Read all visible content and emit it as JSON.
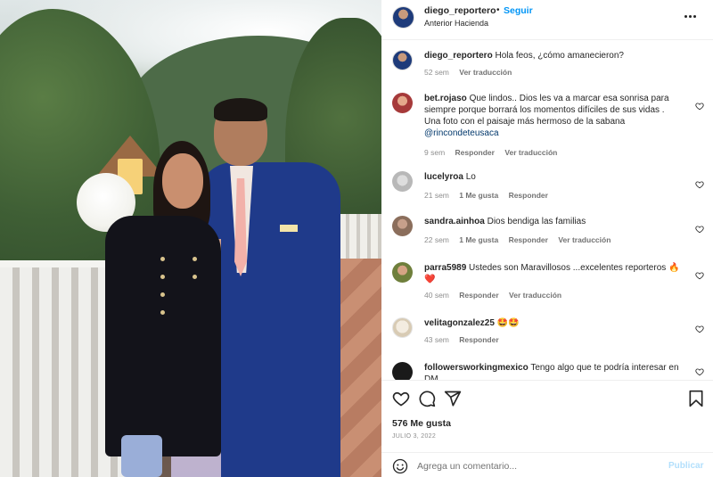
{
  "post": {
    "username": "diego_reportero",
    "separator": "•",
    "follow_label": "Seguir",
    "location": "Anterior Hacienda",
    "caption": "Hola feos, ¿cómo amanecieron?",
    "caption_time": "52 sem",
    "caption_translate": "Ver traducción"
  },
  "comments": [
    {
      "user": "bet.rojaso",
      "text": "Que lindos.. Dios les va a marcar esa sonrisa para siempre porque borrará los momentos difíciles de sus vidas . Una foto con el paisaje más hermoso de la sabana",
      "mention": "@rincondeteusaca",
      "time": "9 sem",
      "likes": "",
      "reply": "Responder",
      "translate": "Ver traducción"
    },
    {
      "user": "lucelyroa",
      "text": "Lo",
      "mention": "",
      "time": "21 sem",
      "likes": "1 Me gusta",
      "reply": "Responder",
      "translate": ""
    },
    {
      "user": "sandra.ainhoa",
      "text": "Dios bendiga las familias",
      "mention": "",
      "time": "22 sem",
      "likes": "1 Me gusta",
      "reply": "Responder",
      "translate": "Ver traducción"
    },
    {
      "user": "parra5989",
      "text": "Ustedes son Maravillosos ...excelentes reporteros 🔥❤️",
      "mention": "",
      "time": "40 sem",
      "likes": "",
      "reply": "Responder",
      "translate": "Ver traducción"
    },
    {
      "user": "velitagonzalez25",
      "text": "🤩🤩",
      "mention": "",
      "time": "43 sem",
      "likes": "",
      "reply": "Responder",
      "translate": ""
    },
    {
      "user": "followersworkingmexico",
      "text": "Tengo algo que te podría interesar en DM",
      "mention": "",
      "time": "",
      "likes": "",
      "reply": "",
      "translate": ""
    }
  ],
  "actions": {
    "likes_count": "576 Me gusta",
    "date": "JULIO 3, 2022",
    "comment_placeholder": "Agrega un comentario...",
    "publish_label": "Publicar"
  },
  "icons": [
    "more-icon",
    "heart-icon",
    "comment-icon",
    "share-icon",
    "bookmark-icon",
    "emoji-icon"
  ],
  "colors": {
    "link_blue": "#0095f6",
    "mention_blue": "#00376b",
    "publish_disabled": "#b2dffc",
    "muted_gray": "#8e8e8e"
  }
}
